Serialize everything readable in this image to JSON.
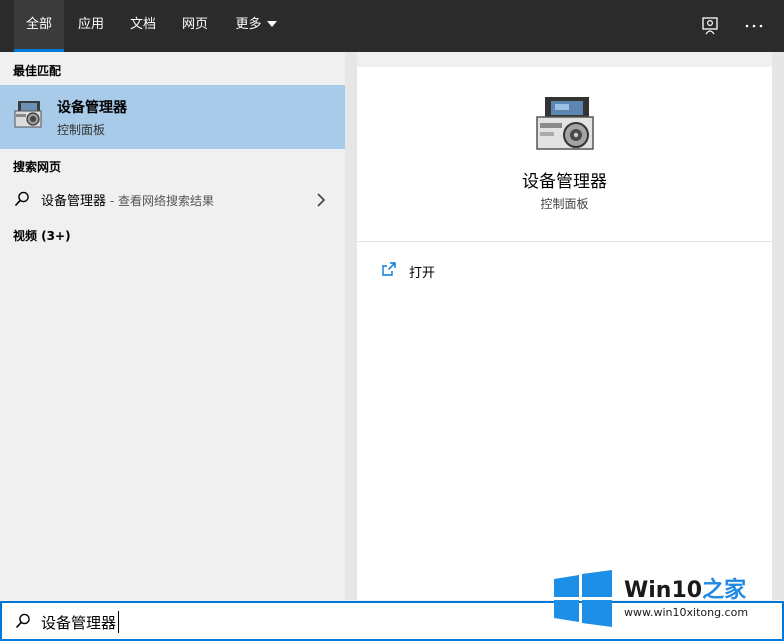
{
  "topbar": {
    "tabs": [
      {
        "label": "全部",
        "active": true
      },
      {
        "label": "应用",
        "active": false
      },
      {
        "label": "文档",
        "active": false
      },
      {
        "label": "网页",
        "active": false
      },
      {
        "label": "更多",
        "active": false
      }
    ],
    "right_icons": [
      "feedback-icon",
      "more-options-icon"
    ]
  },
  "left": {
    "best_match_label": "最佳匹配",
    "best_match": {
      "icon": "device-manager-icon",
      "title": "设备管理器",
      "subtitle": "控制面板"
    },
    "web_label": "搜索网页",
    "web_result": {
      "icon": "search-icon",
      "query": "设备管理器",
      "hint": " - 查看网络搜索结果"
    },
    "videos_label": "视频 (3+)"
  },
  "right": {
    "icon": "device-manager-icon",
    "title": "设备管理器",
    "subtitle": "控制面板",
    "actions": [
      {
        "icon": "open-icon",
        "label": "打开"
      }
    ]
  },
  "search": {
    "value": "设备管理器",
    "icon": "search-icon"
  },
  "watermark": {
    "brand_main": "Win10",
    "brand_accent": "之家",
    "url": "www.win10xitong.com"
  },
  "colors": {
    "accent": "#0078d7",
    "selected_bg": "#a8cbe9",
    "topbar_bg": "#2b2b2b"
  }
}
